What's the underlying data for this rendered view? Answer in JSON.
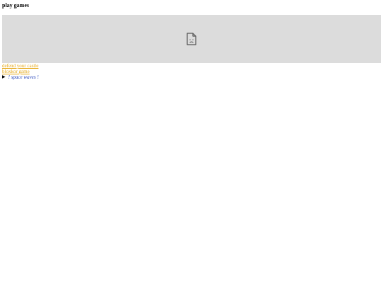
{
  "page": {
    "title": "play games"
  },
  "embed": {
    "icon": "broken-page-icon",
    "background_color": "#dcdcdc"
  },
  "games": {
    "links": [
      {
        "label": "defend your castle"
      },
      {
        "label": "bloxkor game"
      }
    ],
    "link_color": "#e6a817"
  },
  "disclosure": {
    "marker": "▶",
    "label": "! space waves !",
    "label_color": "#1f3fb8"
  }
}
